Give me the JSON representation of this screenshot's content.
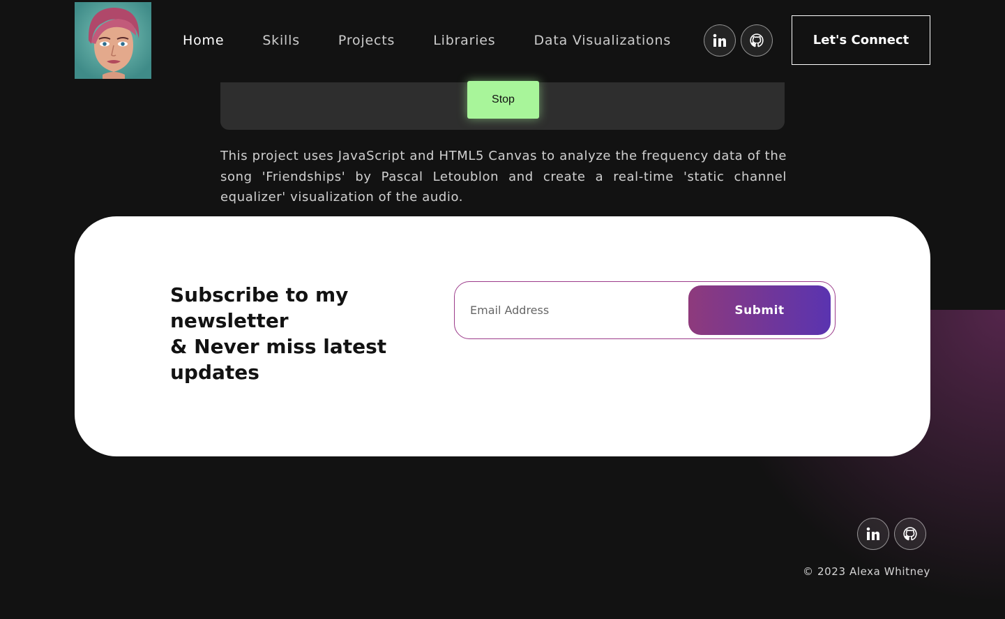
{
  "header": {
    "nav": [
      {
        "label": "Home",
        "active": true
      },
      {
        "label": "Skills",
        "active": false
      },
      {
        "label": "Projects",
        "active": false
      },
      {
        "label": "Libraries",
        "active": false
      },
      {
        "label": "Data Visualizations",
        "active": false
      }
    ],
    "social_icons": [
      "linkedin-icon",
      "github-icon"
    ],
    "connect_label": "Let's Connect"
  },
  "project": {
    "stop_label": "Stop",
    "description": "This project uses JavaScript and HTML5 Canvas to analyze the frequency data of the song 'Friendships' by Pascal Letoublon and create a real-time 'static channel equalizer' visualization of the audio."
  },
  "newsletter": {
    "title_line1": "Subscribe to my newsletter",
    "title_line2": "& Never miss latest updates",
    "email_placeholder": "Email Address",
    "submit_label": "Submit"
  },
  "footer": {
    "social_icons": [
      "linkedin-icon",
      "github-icon"
    ],
    "copyright": "© 2023 Alexa Whitney"
  },
  "colors": {
    "background": "#121212",
    "stop_button": "#a8f59a",
    "submit_gradient_start": "#8e3a7c",
    "submit_gradient_end": "#5a34b0"
  }
}
